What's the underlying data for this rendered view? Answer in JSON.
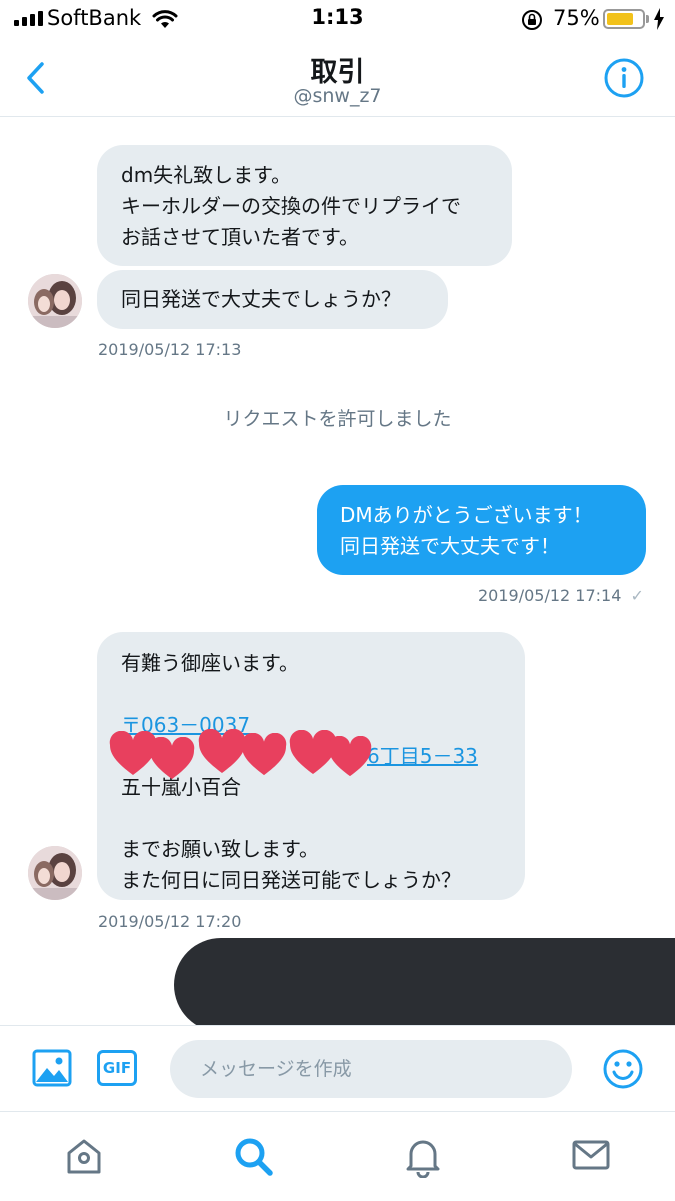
{
  "status_bar": {
    "carrier": "SoftBank",
    "time": "1:13",
    "battery_percent": "75%",
    "battery_level": 0.75,
    "icons": [
      "signal-icon",
      "wifi-icon",
      "orientation-lock-icon",
      "battery-icon",
      "charging-bolt-icon"
    ]
  },
  "header": {
    "title": "取引",
    "handle": "@snw_z7",
    "icons": [
      "back-chevron-icon",
      "info-icon"
    ]
  },
  "conversation": {
    "msg1": "dm失礼致します。\nキーホルダーの交換の件でリプライで\nお話させて頂いた者です。",
    "msg2": "同日発送で大丈夫でしょうか？",
    "time1": "2019/05/12 17:13",
    "system_notice": "リクエストを許可しました",
    "msg3": "DMありがとうございます！\n同日発送で大丈夫です！",
    "time2": "2019/05/12 17:14",
    "time2_check": "✓",
    "msg4_greeting": "有難う御座います。",
    "msg4_postal": "〒063－0037",
    "msg4_address_visible": "6丁目5－33",
    "msg4_name": "五十嵐小百合",
    "msg4_closing": "までお願い致します。\nまた何日に同日発送可能でしょうか？",
    "time3": "2019/05/12 17:20",
    "heart_stickers": 6,
    "redacted_message": true
  },
  "composer": {
    "placeholder": "メッセージを作成",
    "gif_label": "GIF",
    "icons": [
      "image-icon",
      "emoji-icon"
    ]
  },
  "tabbar": {
    "tabs": [
      "home-icon",
      "search-icon",
      "notifications-icon",
      "messages-icon"
    ],
    "active": "search-icon"
  },
  "colors": {
    "accent": "#1da1f2",
    "link": "#1b95e0",
    "incoming_bubble": "#e6ecf0",
    "muted_text": "#657786",
    "heart": "#e8405e",
    "redaction": "#2b2e33",
    "battery": "#f2c21b"
  }
}
